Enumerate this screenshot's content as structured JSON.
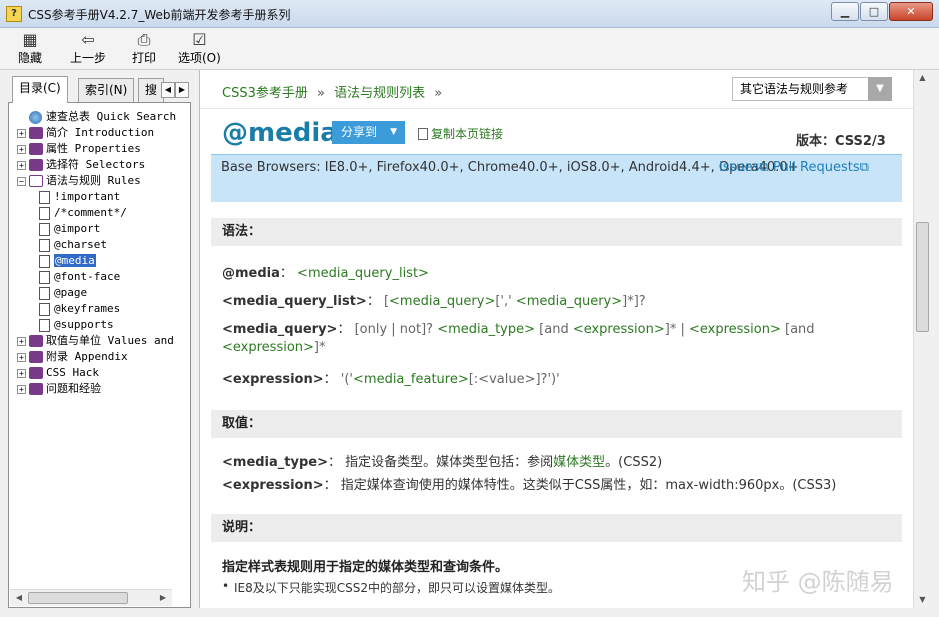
{
  "window": {
    "title": "CSS参考手册V4.2.7_Web前端开发参考手册系列",
    "app_icon": "?",
    "buttons": [
      "▁",
      "□",
      "✕"
    ]
  },
  "toolbar": [
    {
      "name": "hide",
      "label": "隐藏",
      "icon": "▦"
    },
    {
      "name": "back",
      "label": "上一步",
      "icon": "⇦"
    },
    {
      "name": "print",
      "label": "打印",
      "icon": "⎙"
    },
    {
      "name": "options",
      "label": "选项(O)",
      "icon": "☑"
    }
  ],
  "left_tabs": [
    "目录(C)",
    "索引(N)",
    "搜"
  ],
  "tree": [
    {
      "type": "leaf-globe",
      "label": "速查总表 Quick Search"
    },
    {
      "type": "book",
      "label": "简介 Introduction"
    },
    {
      "type": "book",
      "label": "属性 Properties"
    },
    {
      "type": "book",
      "label": "选择符 Selectors"
    },
    {
      "type": "book-open",
      "label": "语法与规则 Rules"
    },
    {
      "type": "page",
      "label": "!important"
    },
    {
      "type": "page",
      "label": "/*comment*/"
    },
    {
      "type": "page",
      "label": "@import"
    },
    {
      "type": "page",
      "label": "@charset"
    },
    {
      "type": "page",
      "label": "@media",
      "selected": true
    },
    {
      "type": "page",
      "label": "@font-face"
    },
    {
      "type": "page",
      "label": "@page"
    },
    {
      "type": "page",
      "label": "@keyframes"
    },
    {
      "type": "page",
      "label": "@supports"
    },
    {
      "type": "book",
      "label": "取值与单位 Values and"
    },
    {
      "type": "book",
      "label": "附录 Appendix"
    },
    {
      "type": "book",
      "label": "CSS Hack"
    },
    {
      "type": "book",
      "label": "问题和经验"
    }
  ],
  "breadcrumb": {
    "item1": "CSS3参考手册",
    "sep": "»",
    "item2": "语法与规则列表"
  },
  "other_select": {
    "label": "其它语法与规则参考",
    "arrow": "▼"
  },
  "page": {
    "heading": "@media",
    "share": "分享到",
    "copy_link": "复制本页链接",
    "version": "版本：CSS2/3",
    "browsers": "Base Browsers: IE8.0+, Firefox40.0+, Chrome40.0+, iOS8.0+, Android4.4+, Opera40.0+",
    "issues": "Issues",
    "pull_requests": "Pull Requests"
  },
  "syntax": {
    "heading": "语法：",
    "l1_name": "@media",
    "l1_def": "<media_query_list>",
    "l2_name": "<media_query_list>",
    "l2_a": "[",
    "l2_b": "<media_query>",
    "l2_c": "[',' ",
    "l2_d": "<media_query>",
    "l2_e": "]*]?",
    "l3_name": "<media_query>",
    "l3_a": "[only | not]? ",
    "l3_b": "<media_type>",
    "l3_c": " [and ",
    "l3_d": "<expression>",
    "l3_e": "]* | ",
    "l3_f": "<expression>",
    "l3_g": " [and",
    "l3_h": "<expression>",
    "l3_i": "]*",
    "l4_name": "<expression>",
    "l4_a": "'('",
    "l4_b": "<media_feature>",
    "l4_c": "[:<value>]?')'"
  },
  "values": {
    "heading": "取值：",
    "v1_name": "<media_type>",
    "v1_text": "指定设备类型。媒体类型包括：参阅",
    "v1_link": "媒体类型",
    "v1_tail": "。(CSS2)",
    "v2_name": "<expression>",
    "v2_text": "指定媒体查询使用的媒体特性。这类似于CSS属性，如：max-width:960px。(CSS3)"
  },
  "description": {
    "heading": "说明：",
    "summary": "指定样式表规则用于指定的媒体类型和查询条件。",
    "bullet1": "IE8及以下只能实现CSS2中的部分，即只可以设置媒体类型。"
  },
  "watermark": "知乎 @陈随易"
}
